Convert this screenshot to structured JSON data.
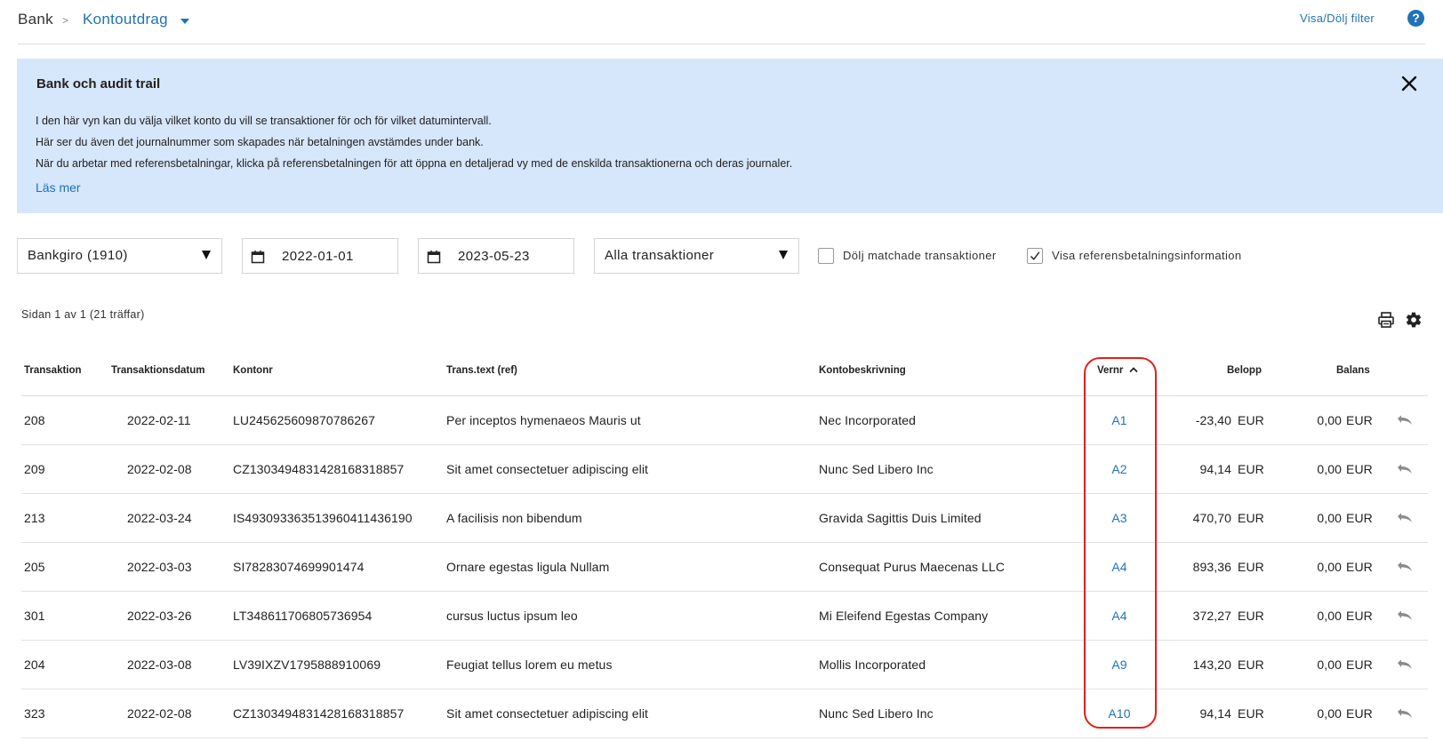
{
  "breadcrumb": {
    "root": "Bank",
    "separator": ">",
    "current": "Kontoutdrag"
  },
  "header": {
    "filter_toggle": "Visa/Dölj filter",
    "help_symbol": "?"
  },
  "info_panel": {
    "title": "Bank och audit trail",
    "lines": [
      "I den här vyn kan du välja vilket konto du vill se transaktioner för och för vilket datumintervall.",
      "Här ser du även det journalnummer som skapades när betalningen avstämdes under bank.",
      "När du arbetar med referensbetalningar, klicka på referensbetalningen för att öppna en detaljerad vy med de enskilda transaktionerna och deras journaler."
    ],
    "read_more": "Läs mer"
  },
  "filters": {
    "account": "Bankgiro (1910)",
    "date_from": "2022-01-01",
    "date_to": "2023-05-23",
    "transaction_type": "Alla transaktioner",
    "hide_matched": {
      "label": "Dölj matchade transaktioner",
      "checked": false
    },
    "show_reference": {
      "label": "Visa referensbetalningsinformation",
      "checked": true
    }
  },
  "pagination": {
    "text": "Sidan 1 av 1  (21 träffar)"
  },
  "table": {
    "columns": [
      "Transaktion",
      "Transaktionsdatum",
      "Kontonr",
      "Trans.text (ref)",
      "Kontobeskrivning",
      "Vernr",
      "Belopp",
      "Balans"
    ],
    "sort_column": "Vernr",
    "sort_direction": "asc",
    "rows": [
      {
        "id": "208",
        "date": "2022-02-11",
        "account": "LU245625609870786267",
        "text": "Per inceptos hymenaeos Mauris ut",
        "description": "Nec Incorporated",
        "vernr": "A1",
        "amount": "-23,40",
        "amount_cur": "EUR",
        "balance": "0,00",
        "balance_cur": "EUR"
      },
      {
        "id": "209",
        "date": "2022-02-08",
        "account": "CZ1303494831428168318857",
        "text": "Sit amet consectetuer adipiscing elit",
        "description": "Nunc Sed Libero Inc",
        "vernr": "A2",
        "amount": "94,14",
        "amount_cur": "EUR",
        "balance": "0,00",
        "balance_cur": "EUR"
      },
      {
        "id": "213",
        "date": "2022-03-24",
        "account": "IS493093363513960411436190",
        "text": "A facilisis non bibendum",
        "description": "Gravida Sagittis Duis Limited",
        "vernr": "A3",
        "amount": "470,70",
        "amount_cur": "EUR",
        "balance": "0,00",
        "balance_cur": "EUR"
      },
      {
        "id": "205",
        "date": "2022-03-03",
        "account": "SI78283074699901474",
        "text": "Ornare egestas ligula Nullam",
        "description": "Consequat Purus Maecenas LLC",
        "vernr": "A4",
        "amount": "893,36",
        "amount_cur": "EUR",
        "balance": "0,00",
        "balance_cur": "EUR"
      },
      {
        "id": "301",
        "date": "2022-03-26",
        "account": "LT348611706805736954",
        "text": "cursus luctus ipsum leo",
        "description": "Mi Eleifend Egestas Company",
        "vernr": "A4",
        "amount": "372,27",
        "amount_cur": "EUR",
        "balance": "0,00",
        "balance_cur": "EUR"
      },
      {
        "id": "204",
        "date": "2022-03-08",
        "account": "LV39IXZV1795888910069",
        "text": "Feugiat tellus lorem eu metus",
        "description": "Mollis Incorporated",
        "vernr": "A9",
        "amount": "143,20",
        "amount_cur": "EUR",
        "balance": "0,00",
        "balance_cur": "EUR"
      },
      {
        "id": "323",
        "date": "2022-02-08",
        "account": "CZ1303494831428168318857",
        "text": "Sit amet consectetuer adipiscing elit",
        "description": "Nunc Sed Libero Inc",
        "vernr": "A10",
        "amount": "94,14",
        "amount_cur": "EUR",
        "balance": "0,00",
        "balance_cur": "EUR"
      }
    ]
  },
  "colors": {
    "accent": "#1f73b7",
    "info_bg": "#d6e6fb",
    "highlight": "#e0201c"
  },
  "icons": [
    "help-icon",
    "close-icon",
    "calendar-icon",
    "print-icon",
    "gear-icon",
    "undo-icon",
    "chevron-up-icon"
  ]
}
